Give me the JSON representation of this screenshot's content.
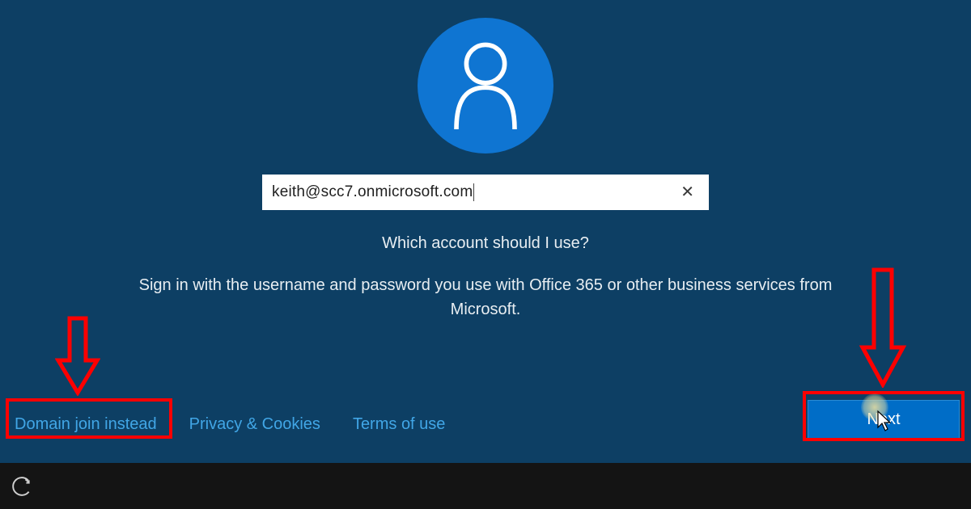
{
  "account": {
    "email_value": "keith@scc7.onmicrosoft.com",
    "clear_glyph": "✕"
  },
  "prompts": {
    "which_account": "Which account should I use?",
    "instruction": "Sign in with the username and password you use with Office 365 or other business services from Microsoft."
  },
  "links": {
    "domain_join": "Domain join instead",
    "privacy": "Privacy & Cookies",
    "terms": "Terms of use"
  },
  "buttons": {
    "next": "Next"
  }
}
